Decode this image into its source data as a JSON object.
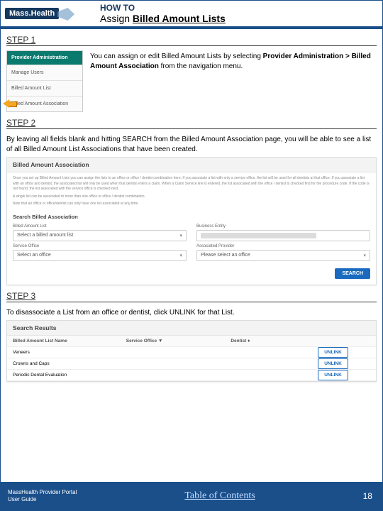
{
  "header": {
    "logo": "Mass.Health",
    "howto": "HOW TO",
    "title_plain": "Assign ",
    "title_bold": "Billed Amount Lists"
  },
  "step1": {
    "label": "STEP 1",
    "text_a": "You can assign or edit Billed Amount Lists by selecting ",
    "text_b": "Provider Administration > Billed Amount Association",
    "text_c": " from the navigation menu.",
    "nav_head": "Provider Administration",
    "nav_items": [
      "Manage Users",
      "Billed Amount List",
      "Billed Amount Association"
    ]
  },
  "step2": {
    "label": "STEP 2",
    "text": "By leaving all fields blank and hitting SEARCH from the Billed Amount Association page, you will be able to see a list of all Billed Amount List Associations that have been created.",
    "panel_title": "Billed Amount Association",
    "panel_desc1": "Once you set up Billed Amount Lists you can assign the lists to an office or office / dentist combination here. If you associate a list with only a service office, the list will be used for all dentists at that office. If you associate a list with an office and dentist, the associated list will only be used when that dentist enters a claim. When a Claim Service line is entered, the list associated with the office / dentist is checked first for the procedure code. If the code is not found, the list associated with the service office is checked next.",
    "panel_desc2": "A single list can be associated to more than one office or office / dentist combination.",
    "panel_desc3": "Note that an office or office/dentist can only have one list associated at any time.",
    "search_sub": "Search Billed Association",
    "f1_label": "Billed Amount List",
    "f1_value": "Select a billed amount list",
    "f2_label": "Business Entity",
    "f3_label": "Service Office",
    "f3_value": "Select an office",
    "f4_label": "Associated Provider",
    "f4_value": "Please select an office",
    "search_btn": "SEARCH"
  },
  "step3": {
    "label": "STEP 3",
    "text": "To disassociate a List from an office or dentist, click UNLINK for that List.",
    "panel_title": "Search Results",
    "col1": "Billed Amount List Name",
    "col2": "Service Office ▼",
    "col3": "Dentist ♦",
    "rows": [
      {
        "name": "Veneers"
      },
      {
        "name": "Crowns and Caps"
      },
      {
        "name": "Periodic Dental Evaluation"
      }
    ],
    "unlink": "UNLINK"
  },
  "footer": {
    "left1": "MassHealth Provider Portal",
    "left2": "User Guide",
    "toc": "Table of Contents",
    "page": "18"
  }
}
